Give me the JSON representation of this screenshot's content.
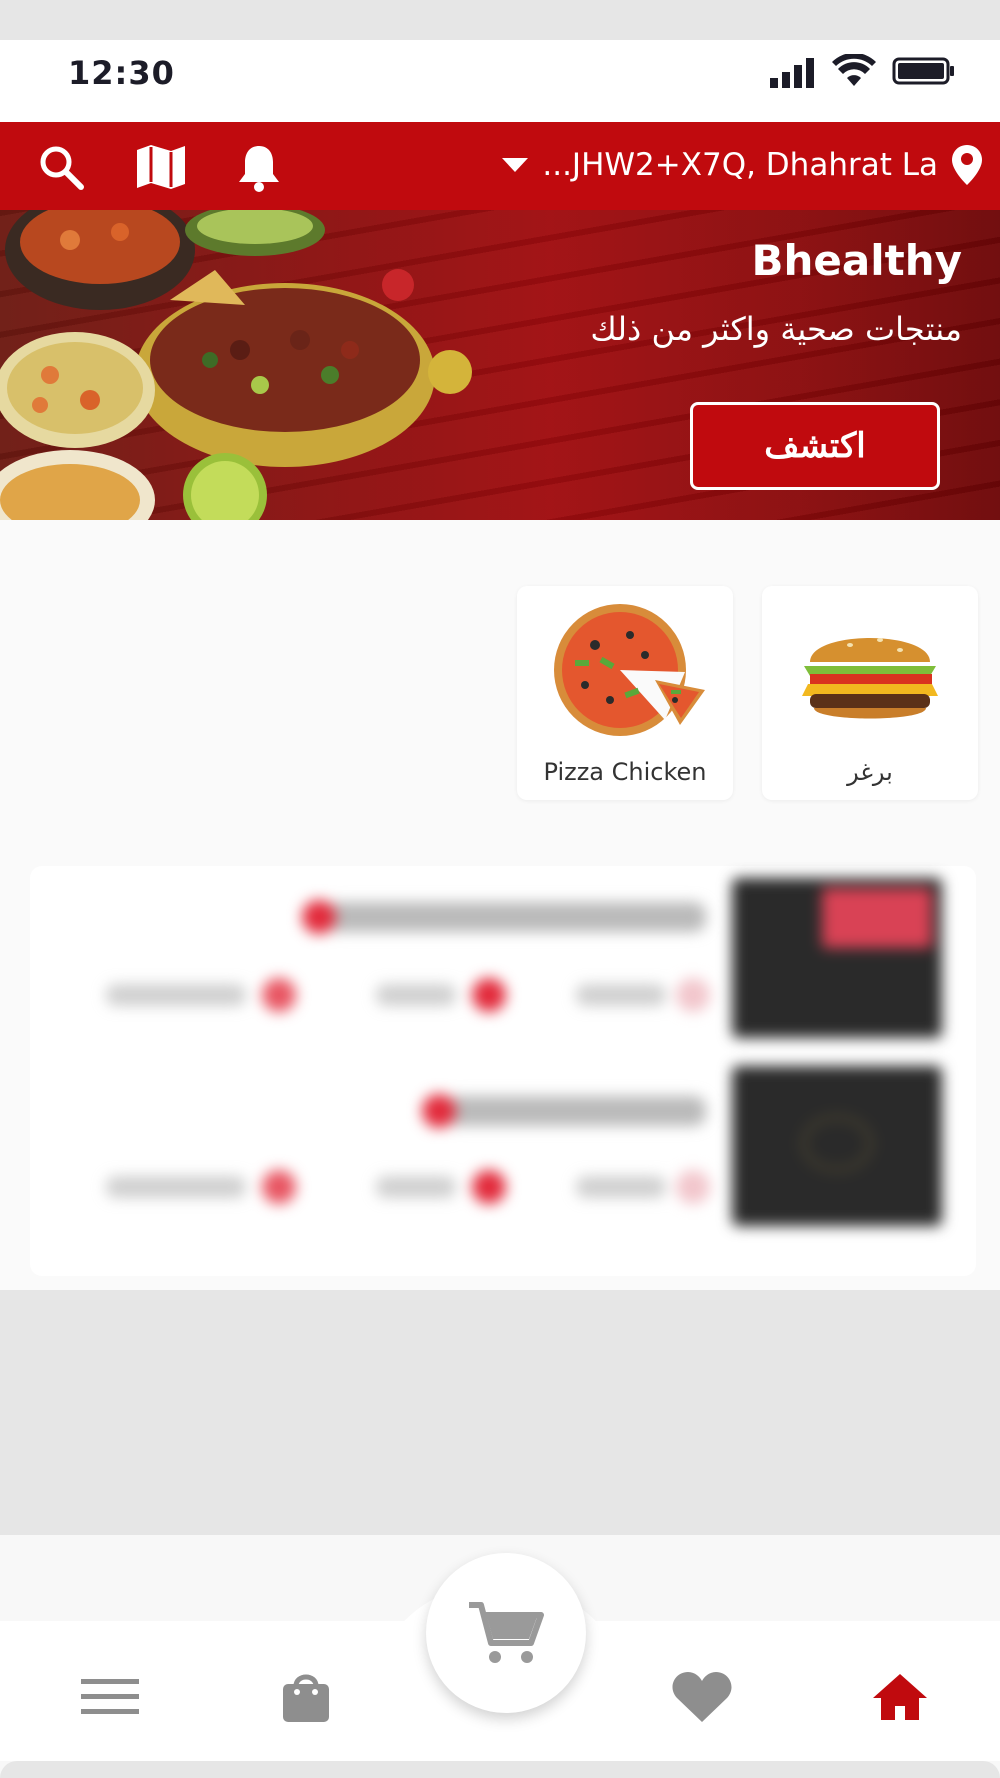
{
  "status_bar": {
    "time": "12:30"
  },
  "header": {
    "location_text": "...JHW2+X7Q, Dhahrat La",
    "icons": [
      "search-icon",
      "map-icon",
      "bell-icon",
      "chevron-down-icon",
      "location-pin-icon"
    ],
    "color": "#c00a0e"
  },
  "banner": {
    "title": "Bhealthy",
    "subtitle": "منتجات صحية واكثر من ذلك",
    "cta_label": "اكتشف"
  },
  "categories": [
    {
      "label": "برغر",
      "icon": "burger"
    },
    {
      "label": "Pizza Chicken",
      "icon": "pizza"
    }
  ],
  "bottom_nav": {
    "items": [
      "home-icon",
      "heart-icon",
      "cart-icon",
      "bag-icon",
      "menu-icon"
    ],
    "active": "home-icon",
    "accent": "#c00a0e"
  }
}
